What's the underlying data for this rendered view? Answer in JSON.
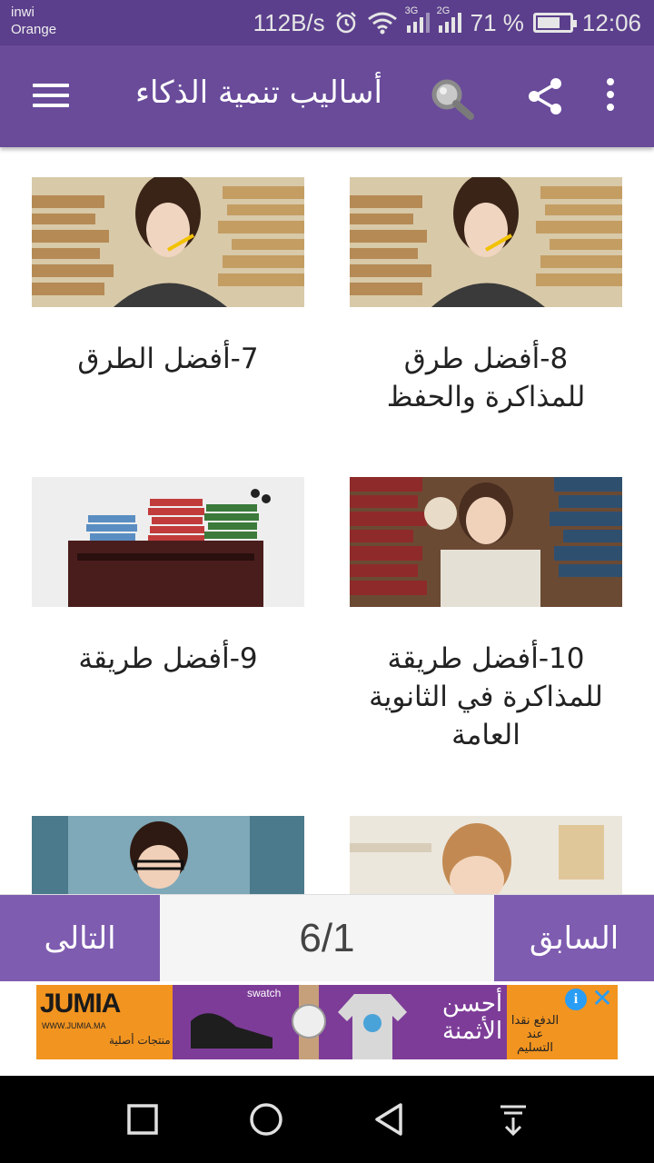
{
  "status_bar": {
    "carrier_line1": "inwi",
    "carrier_line2": "Orange",
    "net_speed": "112B/s",
    "sim1_tag": "3G",
    "sim2_tag": "2G",
    "battery_percent": "71 %",
    "battery_level": 0.71,
    "time": "12:06"
  },
  "app_bar": {
    "title": "أساليب تنمية الذكاء",
    "icons": [
      "menu-icon",
      "search-icon",
      "share-icon",
      "more-vert-icon"
    ]
  },
  "cards": [
    {
      "title": "8-أفضل طرق للمذاكرة والحفظ",
      "image": "girl-thinking-books"
    },
    {
      "title": "7-أفضل الطرق",
      "image": "girl-thinking-books"
    },
    {
      "title": "10-أفضل طريقة للمذاكرة في الثانوية العامة",
      "image": "girl-books-teddy"
    },
    {
      "title": "9-أفضل طريقة",
      "image": "desk-with-books"
    },
    {
      "title": "",
      "image": "boy-studying"
    },
    {
      "title": "",
      "image": "girl-library"
    }
  ],
  "pager": {
    "prev_label": "السابق",
    "next_label": "التالى",
    "page_indicator": "6/1"
  },
  "ad": {
    "brand": "JUMIA",
    "url": "WWW.JUMIA.MA",
    "authentic": "منتجات أصلية",
    "watch_brand": "swatch",
    "headline": "أحسن الأثمنة",
    "payment": "الدفع نقدا عند التسليم",
    "info_label": "i",
    "close_label": "✕",
    "colors": {
      "orange": "#f29420",
      "purple": "#7d3c98"
    }
  },
  "nav_bar": {
    "buttons": [
      "recents-square-icon",
      "home-circle-icon",
      "back-triangle-icon",
      "notifications-pull-down-icon"
    ]
  },
  "colors": {
    "status_bar": "#5b3f8c",
    "app_bar": "#694b9a",
    "pager_button": "#7e5cb0"
  }
}
